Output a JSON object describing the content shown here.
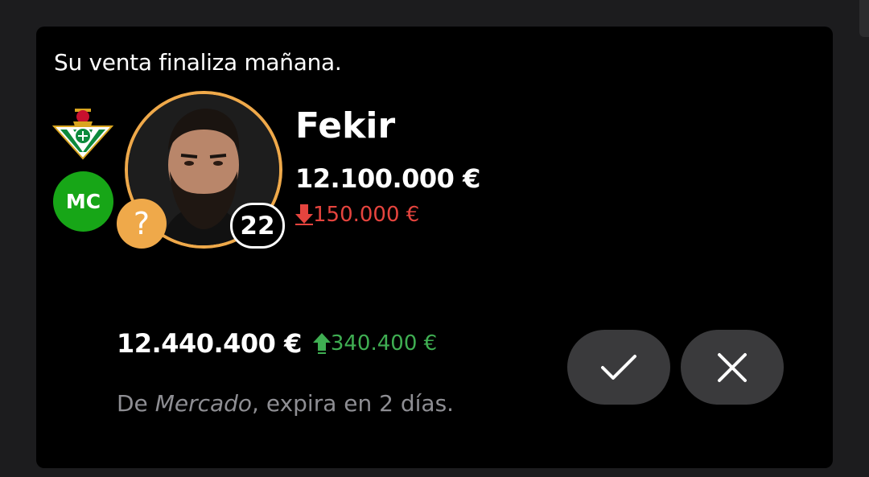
{
  "card": {
    "headline": "Su venta finaliza mañana."
  },
  "player": {
    "position": "MC",
    "status_icon": "question-mark",
    "status_symbol": "?",
    "shirt_number": "22",
    "name": "Fekir",
    "market_value": "12.100.000 €",
    "value_change": "150.000 €",
    "value_change_direction": "down",
    "ring_color": "#efa94a",
    "team_crest": "real-betis-crest"
  },
  "offer": {
    "amount": "12.440.400 €",
    "difference": "340.400 €",
    "difference_direction": "up",
    "source_prefix": "De ",
    "source_name": "Mercado",
    "source_suffix": ", expira en 2 días."
  },
  "actions": {
    "accept_icon": "checkmark-icon",
    "reject_icon": "close-icon"
  },
  "colors": {
    "positive": "#3fae52",
    "negative": "#e5443e",
    "position_badge": "#17a617",
    "button_bg": "#3a3a3c"
  }
}
